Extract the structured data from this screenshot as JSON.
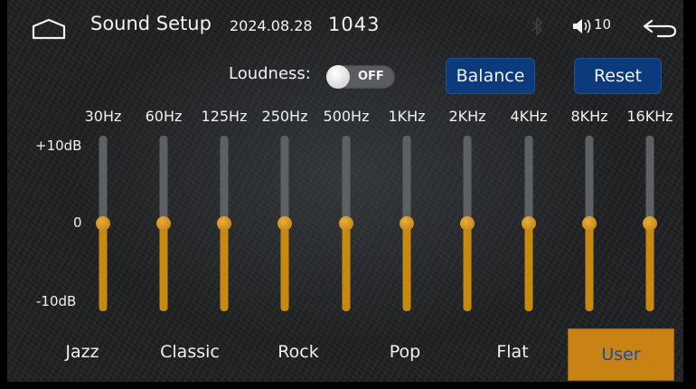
{
  "status_bar": {
    "title": "Sound Setup",
    "date": "2024.08.28",
    "time": "1043",
    "volume_level": "10",
    "icons": [
      "home-icon",
      "bluetooth-icon",
      "volume-icon",
      "back-icon"
    ]
  },
  "controls": {
    "loudness_label": "Loudness:",
    "loudness_state": "OFF",
    "balance_label": "Balance",
    "reset_label": "Reset"
  },
  "equalizer": {
    "db_labels": {
      "top": "+10dB",
      "mid": "0",
      "bottom": "-10dB"
    },
    "range_db": [
      -10,
      10
    ],
    "bands": [
      {
        "freq": "30Hz",
        "gain_db": 0
      },
      {
        "freq": "60Hz",
        "gain_db": 0
      },
      {
        "freq": "125Hz",
        "gain_db": 0
      },
      {
        "freq": "250Hz",
        "gain_db": 0
      },
      {
        "freq": "500Hz",
        "gain_db": 0
      },
      {
        "freq": "1KHz",
        "gain_db": 0
      },
      {
        "freq": "2KHz",
        "gain_db": 0
      },
      {
        "freq": "4KHz",
        "gain_db": 0
      },
      {
        "freq": "8KHz",
        "gain_db": 0
      },
      {
        "freq": "16KHz",
        "gain_db": 0
      }
    ]
  },
  "presets": {
    "items": [
      "Jazz",
      "Classic",
      "Rock",
      "Pop",
      "Flat",
      "User"
    ],
    "selected": "User"
  },
  "colors": {
    "accent": "#c68a12",
    "button": "#0b3a7d",
    "selected_text": "#1a4ea8",
    "track": "#5d6063"
  }
}
